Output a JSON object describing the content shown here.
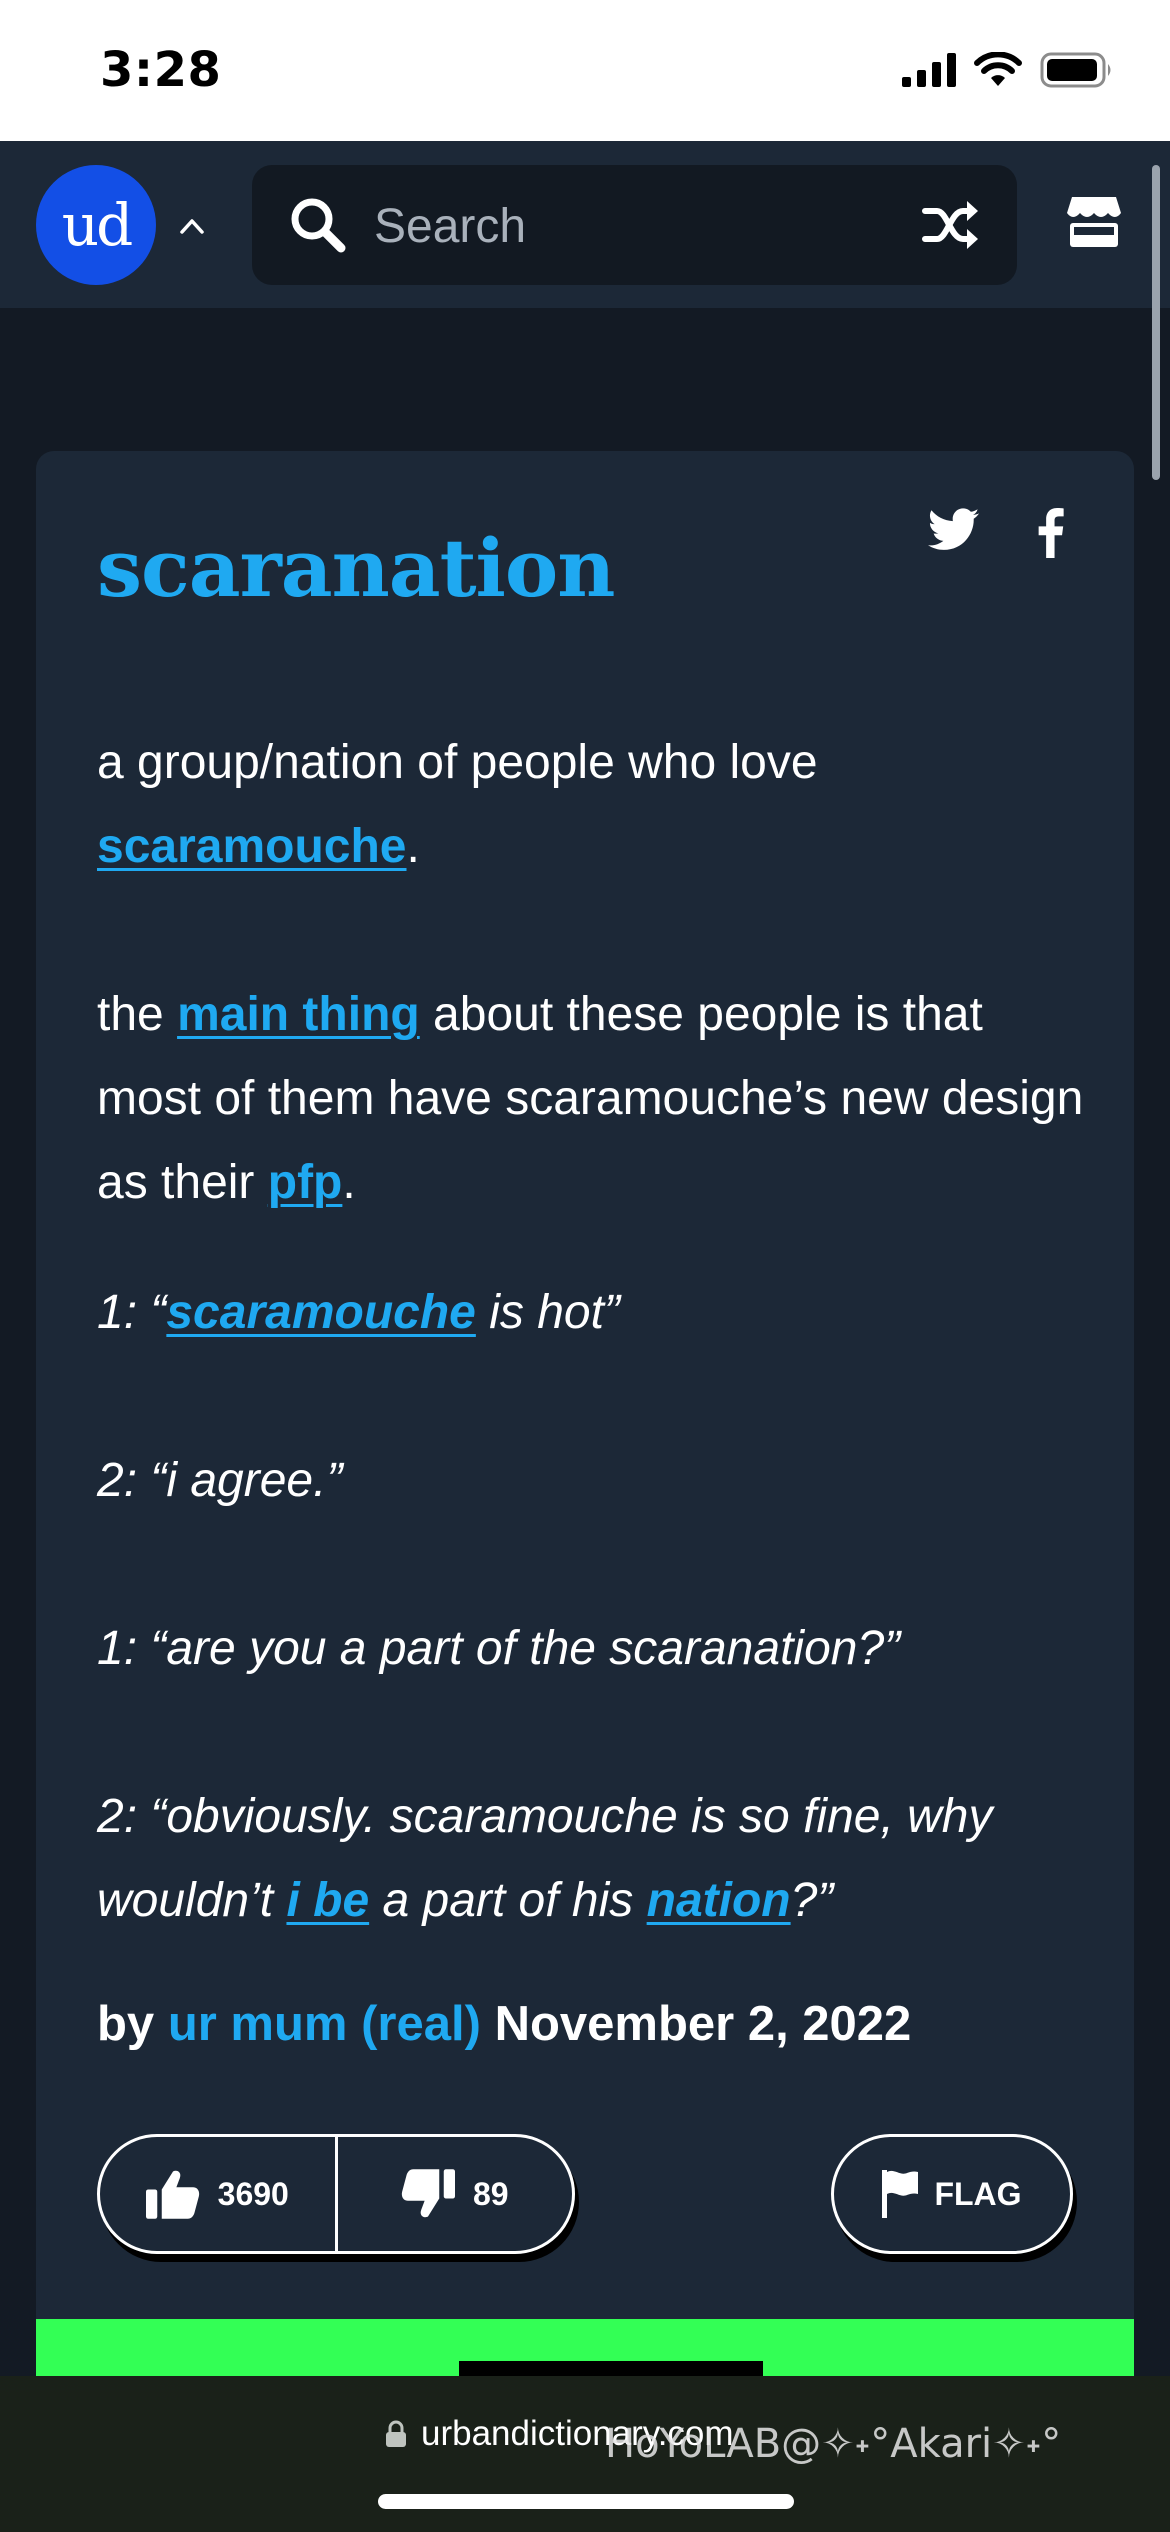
{
  "status_bar": {
    "time": "3:28"
  },
  "header": {
    "logo_text": "ud",
    "search_placeholder": "Search"
  },
  "definition": {
    "word": "scaranation",
    "meaning": {
      "p1_text1": "a group/nation of people who love ",
      "p1_link1": "scaramouche",
      "p1_text2": ".",
      "p2_text1": "the ",
      "p2_link1": "main thing",
      "p2_text2": " about these people is that most of them have scaramouche’s new design as their ",
      "p2_link2": "pfp",
      "p2_text3": "."
    },
    "example": {
      "l1_text1": "1: “",
      "l1_link1": "scaramouche",
      "l1_text2": " is hot”",
      "l2": "2: “i agree.”",
      "l3": "1: “are you a part of the scaranation?”",
      "l4_text1": "2: “obviously. scaramouche is so fine, why wouldn’t ",
      "l4_link1": "i be",
      "l4_text2": " a part of his ",
      "l4_link2": "nation",
      "l4_text3": "?”"
    },
    "contributor": {
      "by": "by",
      "author": "ur mum (real)",
      "date": "November 2, 2022"
    },
    "votes": {
      "up": "3690",
      "down": "89"
    },
    "flag_label": "FLAG"
  },
  "browser": {
    "url": "urbandictionary.com"
  },
  "watermark": "HoYoLAB@✧˖°Akari✧˖°",
  "colors": {
    "accent": "#1fa9f1",
    "logo_bg": "#134fe6",
    "card_bg": "#1c2837",
    "page_bg": "#131a24",
    "ad_green": "#33ff55"
  }
}
